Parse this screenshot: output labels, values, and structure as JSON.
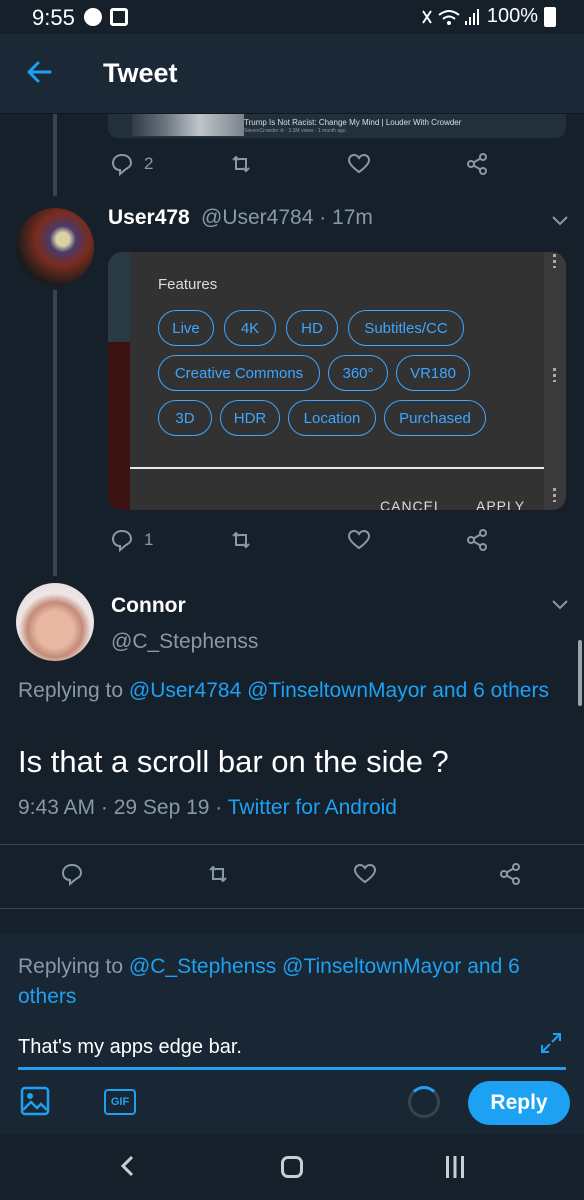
{
  "status_bar": {
    "time": "9:55",
    "battery": "100%"
  },
  "header": {
    "title": "Tweet"
  },
  "embed_video": {
    "title": "Trump Is Not Racist: Change My Mind | Louder With Crowder",
    "meta": "StevenCrowder ⊘ · 3.3M views · 1 month ago"
  },
  "tweet_top_actions": {
    "reply_count": "2"
  },
  "tweet_user478": {
    "name": "User478",
    "handle_time": "@User4784 · 17m",
    "reply_count": "1",
    "screenshot": {
      "dialog_title": "Features",
      "chips": [
        "Live",
        "4K",
        "HD",
        "Subtitles/CC",
        "Creative Commons",
        "360°",
        "VR180",
        "3D",
        "HDR",
        "Location",
        "Purchased"
      ],
      "cancel": "CANCEL",
      "apply": "APPLY"
    }
  },
  "main_tweet": {
    "name": "Connor",
    "handle": "@C_Stephenss",
    "replying_prefix": "Replying to ",
    "replying_targets": "@User4784 @TinseltownMayor and 6 others",
    "text": "Is that a scroll bar on the side ?",
    "meta": "9:43 AM · 29 Sep 19 · ",
    "source": "Twitter for Android"
  },
  "compose": {
    "replying_prefix": "Replying to ",
    "replying_targets": "@C_Stephenss @TinseltownMayor and 6 others",
    "text": "That's my apps edge bar.",
    "gif_label": "GIF",
    "reply_button": "Reply"
  },
  "colors": {
    "background": "#15202b",
    "accent": "#1da1f2",
    "muted": "#8899a6"
  }
}
